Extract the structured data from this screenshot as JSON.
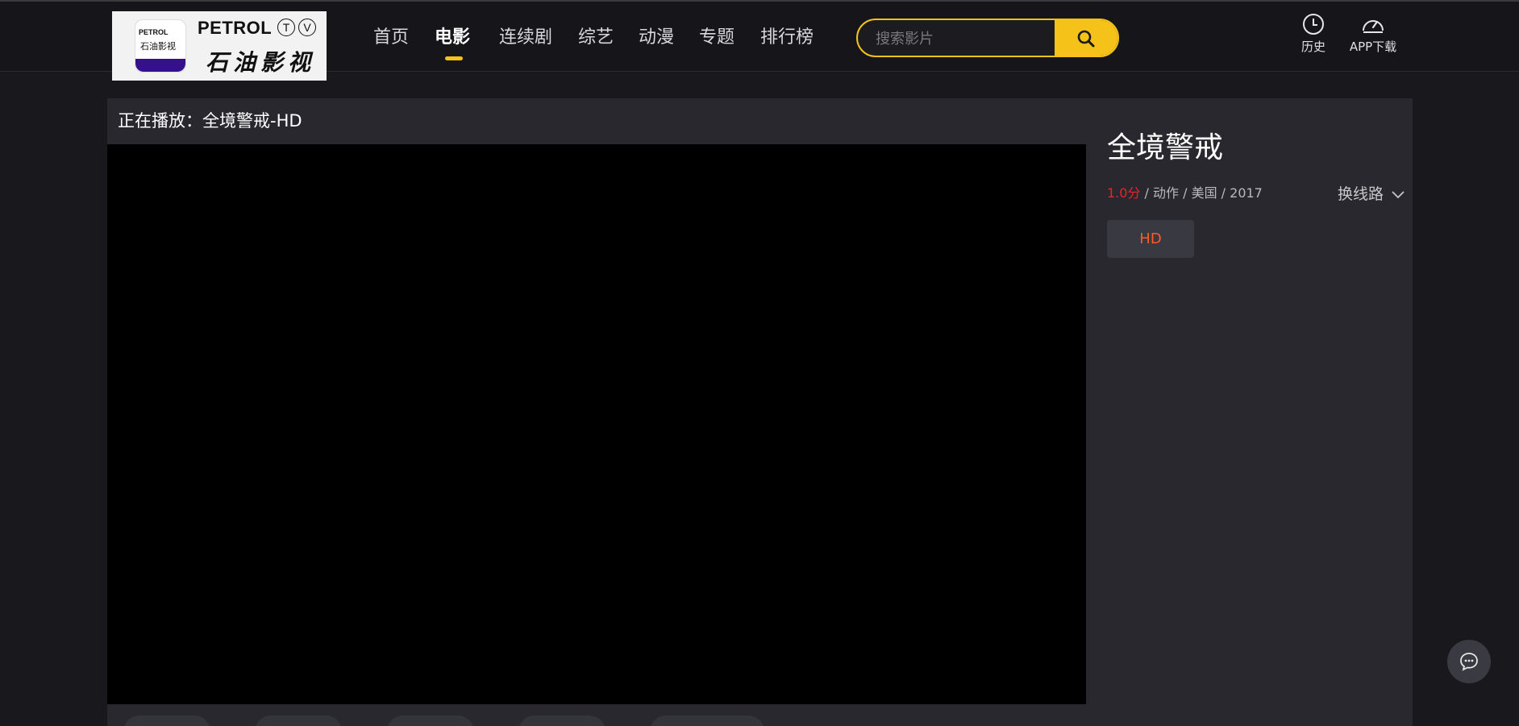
{
  "logo": {
    "badge_text": "PETROL",
    "badge_cn": "石油影视",
    "brand_en": "PETROL",
    "brand_tv": [
      "T",
      "V"
    ],
    "brand_cn": "石油影视"
  },
  "nav": {
    "items": [
      {
        "label": "首页",
        "active": false
      },
      {
        "label": "电影",
        "active": true
      },
      {
        "label": "连续剧",
        "active": false
      },
      {
        "label": "综艺",
        "active": false
      },
      {
        "label": "动漫",
        "active": false
      },
      {
        "label": "专题",
        "active": false
      },
      {
        "label": "排行榜",
        "active": false
      }
    ]
  },
  "search": {
    "placeholder": "搜索影片",
    "icon": "search-icon"
  },
  "header_actions": {
    "history_label": "历史",
    "history_icon": "clock-icon",
    "app_label": "APP下载",
    "app_icon": "speedometer-icon"
  },
  "player": {
    "now_playing": "正在播放：全境警戒-HD"
  },
  "sidebar": {
    "title": "全境警戒",
    "score": "1.0分",
    "meta_rest": " / 动作 / 美国 / 2017",
    "switch_label": "换线路",
    "episodes": [
      "HD"
    ]
  },
  "colors": {
    "accent": "#f5c21a",
    "score": "#e8242b",
    "episode_text": "#ff5a28",
    "background": "#18181d",
    "panel": "#28282e"
  },
  "chat": {
    "icon": "chat-icon"
  }
}
